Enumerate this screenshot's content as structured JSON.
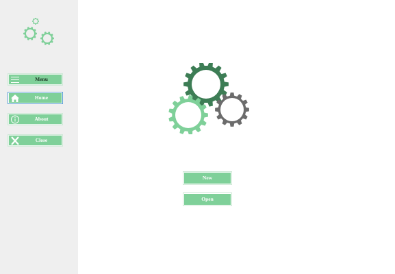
{
  "sidebar": {
    "items": [
      {
        "label": "Menu",
        "icon": "hamburger-icon"
      },
      {
        "label": "Home",
        "icon": "home-icon"
      },
      {
        "label": "About",
        "icon": "info-icon"
      },
      {
        "label": "Close",
        "icon": "close-icon"
      }
    ]
  },
  "main": {
    "new_label": "New",
    "open_label": "Open"
  },
  "colors": {
    "accent": "#7fd099",
    "sidebar_bg": "#efefef",
    "gear_dark": "#3d7d55",
    "gear_light": "#7fd099",
    "gear_gray": "#6c6c6c"
  }
}
